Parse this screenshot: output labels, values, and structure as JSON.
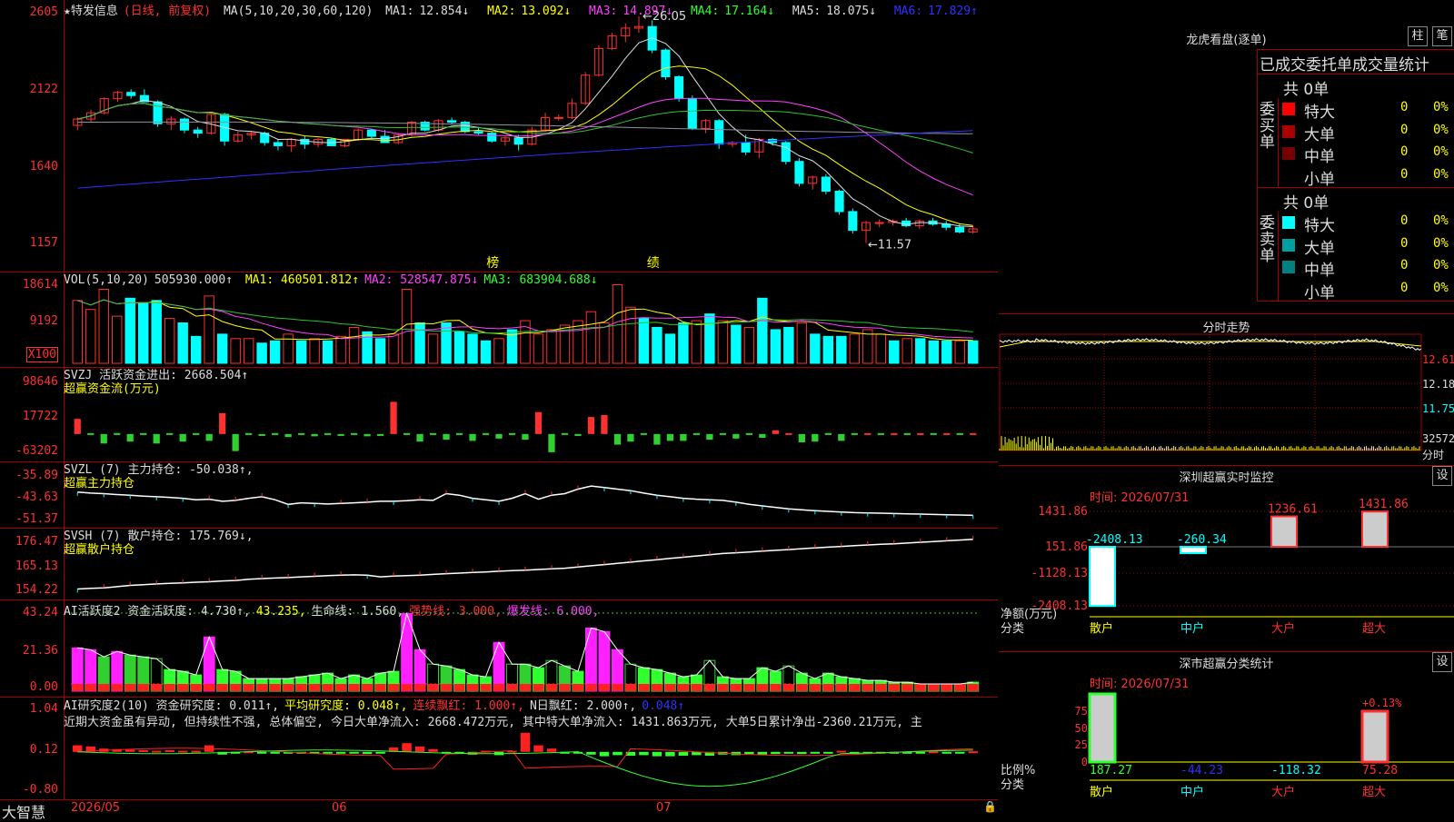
{
  "colors": {
    "up": "#ff3030",
    "down": "#00ffff",
    "ma1": "#dddddd",
    "ma2": "#ffff00",
    "ma3": "#ff40ff",
    "ma4": "#30c030",
    "ma5": "#9090a0",
    "ma6": "#3030ff",
    "grid": "#a00000"
  },
  "main": {
    "title": "★特发信息",
    "title_mode": "(日线, 前复权)",
    "ma_spec": "MA(5,10,20,30,60,120)",
    "ma_items": [
      {
        "label": "MA1:",
        "value": "12.854↓"
      },
      {
        "label": "MA2:",
        "value": "13.092↓"
      },
      {
        "label": "MA3:",
        "value": "14.897↓"
      },
      {
        "label": "MA4:",
        "value": "17.164↓"
      },
      {
        "label": "MA5:",
        "value": "18.075↓"
      },
      {
        "label": "MA6:",
        "value": "17.829↑"
      }
    ],
    "high_label": "←26.05",
    "low_label": "←11.57",
    "markers": [
      {
        "text": "榜",
        "index": 31
      },
      {
        "text": "绩",
        "index": 43
      }
    ]
  },
  "vol": {
    "title": "VOL(5,10,20)",
    "value": "505930.000↑",
    "ma1": "MA1: 460501.812↑",
    "ma2": "MA2: 528547.875↓",
    "ma3": "MA3: 683904.688↓"
  },
  "svzj": {
    "title": "SVZJ  活跃资金进出: 2668.504↑",
    "subtitle": "超赢资金流(万元)"
  },
  "svzl": {
    "title": "SVZL (7) 主力持仓: -50.038↑,",
    "subtitle": "超赢主力持仓"
  },
  "svsh": {
    "title": "SVSH (7) 散户持仓: 175.769↓,",
    "subtitle": "超赢散户持仓"
  },
  "ai1": {
    "title": "AI活跃度2 资金活跃度: 4.730↑,",
    "v2": "43.235,",
    "life": "生命线: 1.560,",
    "strong": "强势线: 3.000,",
    "burst": "爆发线: 6.000,"
  },
  "ai2": {
    "title": "AI研究度2(10) 资金研究度: 0.011↑,",
    "avg": "平均研究度: 0.048↑,",
    "cont": "连续飘红: 1.000↑,",
    "nday": "N日飘红: 2.000↑,",
    "last": "0.048↑"
  },
  "commentary": "近期大资金虽有异动, 但持续性不强, 总体偏空, 今日大单净流入: 2668.472万元, 其中特大单净流入: 1431.863万元, 大单5日累计净出-2360.21万元, 主",
  "chart_data": [
    {
      "type": "candlestick",
      "name": "price",
      "ylim": [
        1157,
        2605
      ],
      "yticks": [
        "2605",
        "2122",
        "1640",
        "1157"
      ],
      "x": [
        "2026/05",
        "06",
        "07"
      ],
      "ohlc": [
        [
          1910,
          1960,
          1880,
          1950
        ],
        [
          1950,
          2010,
          1930,
          1990
        ],
        [
          1990,
          2090,
          1980,
          2080
        ],
        [
          2080,
          2130,
          2060,
          2120
        ],
        [
          2120,
          2140,
          2080,
          2100
        ],
        [
          2100,
          2140,
          2060,
          2060
        ],
        [
          2060,
          2070,
          1900,
          1920
        ],
        [
          1920,
          1970,
          1880,
          1950
        ],
        [
          1950,
          1960,
          1860,
          1880
        ],
        [
          1880,
          1900,
          1830,
          1860
        ],
        [
          1860,
          1980,
          1850,
          1980
        ],
        [
          1980,
          1990,
          1780,
          1810
        ],
        [
          1810,
          1870,
          1800,
          1850
        ],
        [
          1850,
          1870,
          1820,
          1860
        ],
        [
          1860,
          1870,
          1780,
          1800
        ],
        [
          1800,
          1820,
          1750,
          1780
        ],
        [
          1780,
          1830,
          1740,
          1820
        ],
        [
          1820,
          1840,
          1760,
          1790
        ],
        [
          1790,
          1830,
          1770,
          1820
        ],
        [
          1820,
          1830,
          1780,
          1780
        ],
        [
          1780,
          1820,
          1770,
          1820
        ],
        [
          1820,
          1890,
          1810,
          1880
        ],
        [
          1880,
          1890,
          1830,
          1840
        ],
        [
          1840,
          1880,
          1800,
          1800
        ],
        [
          1800,
          1860,
          1790,
          1850
        ],
        [
          1850,
          1940,
          1840,
          1930
        ],
        [
          1930,
          1940,
          1870,
          1880
        ],
        [
          1880,
          1950,
          1870,
          1940
        ],
        [
          1940,
          1960,
          1920,
          1930
        ],
        [
          1930,
          1940,
          1860,
          1870
        ],
        [
          1870,
          1900,
          1850,
          1860
        ],
        [
          1860,
          1870,
          1800,
          1810
        ],
        [
          1810,
          1840,
          1780,
          1830
        ],
        [
          1830,
          1850,
          1750,
          1790
        ],
        [
          1790,
          1900,
          1780,
          1880
        ],
        [
          1880,
          1990,
          1870,
          1960
        ],
        [
          1960,
          1980,
          1940,
          1960
        ],
        [
          1960,
          2080,
          1950,
          2050
        ],
        [
          2050,
          2250,
          2040,
          2230
        ],
        [
          2230,
          2420,
          2220,
          2400
        ],
        [
          2400,
          2500,
          2390,
          2480
        ],
        [
          2480,
          2560,
          2440,
          2530
        ],
        [
          2530,
          2605,
          2500,
          2540
        ],
        [
          2540,
          2580,
          2370,
          2390
        ],
        [
          2390,
          2400,
          2200,
          2220
        ],
        [
          2220,
          2230,
          2060,
          2080
        ],
        [
          2080,
          2100,
          1880,
          1890
        ],
        [
          1890,
          1950,
          1860,
          1940
        ],
        [
          1940,
          1950,
          1760,
          1790
        ],
        [
          1790,
          1810,
          1770,
          1800
        ],
        [
          1800,
          1850,
          1720,
          1740
        ],
        [
          1740,
          1830,
          1700,
          1820
        ],
        [
          1820,
          1830,
          1780,
          1800
        ],
        [
          1800,
          1810,
          1660,
          1680
        ],
        [
          1680,
          1700,
          1520,
          1540
        ],
        [
          1540,
          1590,
          1500,
          1580
        ],
        [
          1580,
          1600,
          1470,
          1490
        ],
        [
          1490,
          1500,
          1340,
          1360
        ],
        [
          1360,
          1380,
          1220,
          1240
        ],
        [
          1240,
          1300,
          1160,
          1290
        ],
        [
          1290,
          1310,
          1260,
          1290
        ],
        [
          1290,
          1310,
          1270,
          1300
        ],
        [
          1300,
          1320,
          1260,
          1270
        ],
        [
          1270,
          1310,
          1250,
          1300
        ],
        [
          1300,
          1320,
          1270,
          1280
        ],
        [
          1280,
          1300,
          1240,
          1260
        ],
        [
          1260,
          1280,
          1220,
          1230
        ],
        [
          1230,
          1270,
          1220,
          1250
        ]
      ]
    },
    {
      "type": "bar",
      "name": "VOL",
      "ylim": [
        0,
        18614
      ],
      "yticks": [
        "18614",
        "9192",
        "X100"
      ],
      "values": [
        14000,
        12000,
        16500,
        10500,
        14500,
        13500,
        14000,
        10000,
        9000,
        6000,
        15000,
        6500,
        5500,
        5500,
        4500,
        5000,
        6500,
        5000,
        5500,
        5000,
        6000,
        8000,
        7000,
        5500,
        6500,
        16500,
        9000,
        6500,
        9000,
        7000,
        6500,
        5000,
        5500,
        7500,
        9500,
        6500,
        7500,
        8500,
        9500,
        11500,
        9000,
        17500,
        12500,
        10000,
        8000,
        6500,
        9000,
        9500,
        11000,
        9500,
        8500,
        8000,
        14500,
        7500,
        8000,
        9000,
        6500,
        6000,
        6000,
        6500,
        7500,
        6500,
        5000,
        5500,
        5500,
        5000,
        5000,
        5000,
        5000
      ]
    },
    {
      "type": "bar",
      "name": "SVZJ",
      "ylim": [
        -63202,
        98646
      ],
      "yticks": [
        "98646",
        "17722",
        "-63202"
      ],
      "values": [
        40000,
        0,
        -25000,
        0,
        -20000,
        0,
        -25000,
        0,
        -20000,
        0,
        -18000,
        55000,
        -45000,
        0,
        -5000,
        0,
        -8000,
        0,
        -6000,
        0,
        -5000,
        0,
        -6000,
        -5000,
        85000,
        0,
        -20000,
        0,
        -15000,
        0,
        -18000,
        0,
        -12000,
        0,
        -15000,
        58000,
        -48000,
        0,
        -5000,
        45000,
        50000,
        -28000,
        -20000,
        0,
        -28000,
        -18000,
        -18000,
        0,
        -15000,
        0,
        -12000,
        0,
        -10000,
        10000,
        0,
        -22000,
        -20000,
        0,
        -18000,
        0,
        0,
        0,
        0,
        0,
        0,
        0,
        0,
        0,
        0
      ]
    },
    {
      "type": "line",
      "name": "SVZL",
      "ylim": [
        -51.37,
        -35.89
      ],
      "yticks": [
        "-35.89",
        "-43.63",
        "-51.37"
      ],
      "values": [
        -41.5,
        -41.8,
        -42.0,
        -42.3,
        -42.5,
        -42.8,
        -43.0,
        -43.2,
        -43.5,
        -44.0,
        -43.8,
        -44.5,
        -44.2,
        -43.5,
        -43.0,
        -44.0,
        -45.5,
        -45.0,
        -45.2,
        -45.4,
        -45.2,
        -45.0,
        -44.8,
        -44.5,
        -44.5,
        -44.3,
        -44.0,
        -44.2,
        -42.0,
        -42.5,
        -43.5,
        -44.0,
        -44.5,
        -43.5,
        -42.0,
        -43.8,
        -42.5,
        -42.0,
        -40.5,
        -39.5,
        -40.0,
        -40.5,
        -41.0,
        -41.8,
        -42.5,
        -43.0,
        -43.5,
        -43.8,
        -44.0,
        -44.2,
        -44.8,
        -45.5,
        -46.0,
        -46.5,
        -47.0,
        -47.3,
        -47.6,
        -47.8,
        -48.0,
        -48.2,
        -48.3,
        -48.4,
        -48.5,
        -48.6,
        -48.7,
        -48.8,
        -48.9,
        -49.0,
        -49.1
      ]
    },
    {
      "type": "line",
      "name": "SVSH",
      "ylim": [
        154.22,
        176.47
      ],
      "yticks": [
        "176.47",
        "165.13",
        "154.22"
      ],
      "values": [
        155.5,
        155.8,
        156.0,
        156.5,
        157.0,
        157.3,
        157.6,
        157.8,
        158.0,
        158.3,
        158.5,
        158.8,
        159.0,
        159.5,
        159.8,
        160.0,
        160.2,
        160.5,
        160.7,
        161.0,
        161.2,
        161.3,
        161.2,
        160.5,
        160.8,
        161.0,
        161.2,
        161.5,
        161.8,
        162.0,
        162.3,
        162.5,
        162.8,
        163.0,
        163.2,
        163.5,
        163.8,
        164.0,
        164.5,
        165.0,
        165.5,
        166.0,
        166.5,
        167.0,
        167.5,
        168.0,
        168.5,
        169.0,
        169.5,
        170.0,
        170.3,
        170.6,
        171.0,
        171.3,
        171.6,
        172.0,
        172.3,
        172.6,
        172.9,
        173.2,
        173.5,
        173.8,
        174.0,
        174.3,
        174.6,
        174.9,
        175.2,
        175.5,
        175.8
      ]
    },
    {
      "type": "bar",
      "name": "AI活跃度2",
      "ylim": [
        0,
        43.24
      ],
      "yticks": [
        "43.24",
        "21.36",
        "0.00"
      ],
      "values": [
        24,
        23,
        19,
        22,
        20,
        19,
        18,
        12,
        11,
        9,
        30,
        12,
        11,
        7,
        7,
        7,
        7,
        8,
        9,
        10,
        7,
        9,
        7,
        10,
        11,
        43,
        23,
        15,
        14,
        12,
        9,
        8,
        27,
        15,
        15,
        13,
        17,
        14,
        11,
        35,
        33,
        23,
        15,
        13,
        12,
        10,
        8,
        9,
        17,
        8,
        7,
        7,
        13,
        11,
        14,
        10,
        7,
        10,
        8,
        7,
        6,
        6,
        5,
        5,
        4,
        4,
        4,
        4,
        5
      ]
    },
    {
      "type": "bar",
      "name": "AI研究度2(10)",
      "ylim": [
        -0.8,
        1.04
      ],
      "yticks": [
        "1.04",
        "0.12",
        "-0.80"
      ],
      "values": [
        0.12,
        0.1,
        0.06,
        0.05,
        0.04,
        0.03,
        0.02,
        0.03,
        0.02,
        0.02,
        0.12,
        -0.05,
        -0.02,
        0.01,
        -0.02,
        -0.03,
        -0.02,
        -0.03,
        -0.02,
        -0.03,
        -0.02,
        -0.03,
        -0.04,
        -0.02,
        0.08,
        0.16,
        0.1,
        0.05,
        -0.03,
        -0.02,
        -0.05,
        0.02,
        -0.06,
        0.02,
        0.35,
        0.12,
        0.06,
        -0.03,
        -0.02,
        -0.05,
        -0.08,
        -0.06,
        -0.07,
        -0.06,
        -0.08,
        -0.08,
        -0.07,
        -0.06,
        -0.07,
        -0.05,
        -0.06,
        -0.04,
        -0.05,
        -0.04,
        -0.03,
        -0.04,
        -0.03,
        -0.03,
        0.02,
        -0.02,
        -0.02,
        -0.02,
        -0.01,
        -0.01,
        -0.01,
        0.01,
        -0.01,
        -0.01,
        0.01
      ]
    }
  ],
  "right": {
    "panel_title": "龙虎看盘(逐单)",
    "btn1": "柱",
    "btn2": "笔",
    "table_title": "已成交委托单成交量统计",
    "buy_label": "委买单",
    "sell_label": "委卖单",
    "buy_total": "共 0单",
    "sell_total": "共 0单",
    "buy_rows": [
      {
        "name": "特大",
        "val": "0",
        "pct": "0%",
        "color": "#ff0000"
      },
      {
        "name": "大单",
        "val": "0",
        "pct": "0%",
        "color": "#aa0000"
      },
      {
        "name": "中单",
        "val": "0",
        "pct": "0%",
        "color": "#770000"
      },
      {
        "name": "小单",
        "val": "0",
        "pct": "0%",
        "color": "#000000"
      }
    ],
    "sell_rows": [
      {
        "name": "特大",
        "val": "0",
        "pct": "0%",
        "color": "#00ffff"
      },
      {
        "name": "大单",
        "val": "0",
        "pct": "0%",
        "color": "#00a0a0"
      },
      {
        "name": "中单",
        "val": "0",
        "pct": "0%",
        "color": "#008080"
      },
      {
        "name": "小单",
        "val": "0",
        "pct": "0%",
        "color": "#000000"
      }
    ],
    "intraday_title": "分时走势",
    "intraday_ticks": [
      "12.61",
      "12.18",
      "11.75",
      "32572",
      "分时"
    ],
    "monitor_title": "深圳超赢实时监控",
    "monitor_btn": "设",
    "monitor_time": "时间: 2026/07/31",
    "monitor_yticks": [
      "1431.86",
      "151.86",
      "-1128.13",
      "-2408.13"
    ],
    "monitor_ylabel": "净额(万元)",
    "monitor_xlabel": "分类",
    "monitor_cats": [
      "散户",
      "中户",
      "大户",
      "超大"
    ],
    "monitor_values": [
      "-2408.13",
      "-260.34",
      "1236.61",
      "1431.86"
    ],
    "stat_title": "深市超赢分类统计",
    "stat_btn": "设",
    "stat_time": "时间: 2026/07/31",
    "stat_yticks": [
      "75",
      "50",
      "25",
      "0"
    ],
    "stat_ylabel": "比例%",
    "stat_xlabel": "分类",
    "stat_cats": [
      "散户",
      "中户",
      "大户",
      "超大"
    ],
    "stat_values": [
      "187.27",
      "-44.23",
      "-118.32",
      "75.28"
    ],
    "stat_pct": "+0.13%"
  },
  "brand": "大智慧"
}
